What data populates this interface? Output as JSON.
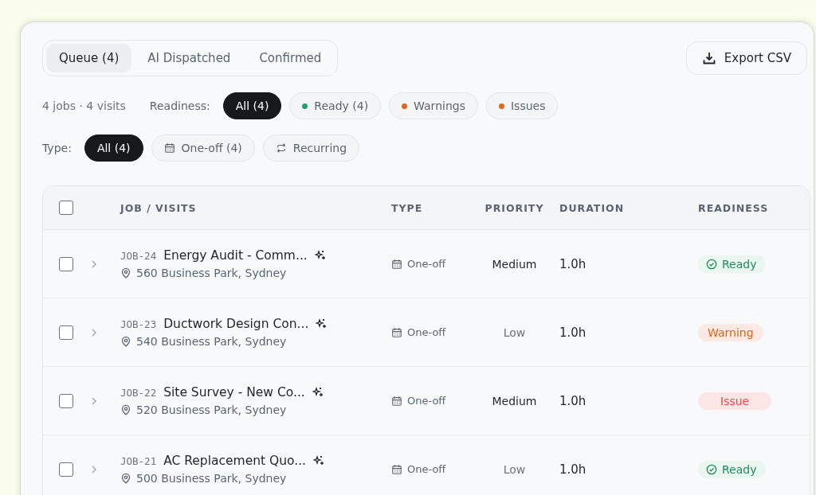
{
  "tabs": [
    {
      "label": "Queue (4)",
      "selected": true
    },
    {
      "label": "AI Dispatched",
      "selected": false
    },
    {
      "label": "Confirmed",
      "selected": false
    }
  ],
  "export_button": "Export CSV",
  "summary": "4 jobs · 4 visits",
  "readiness_filter": {
    "label": "Readiness:",
    "options": [
      {
        "label": "All (4)",
        "selected": true
      },
      {
        "label": "Ready (4)",
        "selected": false,
        "color": "#22a06b"
      },
      {
        "label": "Warnings",
        "selected": false,
        "color": "#e0671c"
      },
      {
        "label": "Issues",
        "selected": false,
        "color": "#e0671c"
      }
    ]
  },
  "type_filter": {
    "label": "Type:",
    "options": [
      {
        "label": "All (4)",
        "selected": true
      },
      {
        "label": "One-off (4)",
        "selected": false,
        "kind": "calendar"
      },
      {
        "label": "Recurring",
        "selected": false,
        "kind": "repeat"
      }
    ]
  },
  "table": {
    "select_all_checked": false,
    "columns": [
      "JOB / VISITS",
      "TYPE",
      "PRIORITY",
      "DURATION",
      "READINESS"
    ],
    "rows": [
      {
        "checked": false,
        "expanded": false,
        "id": "JOB-24",
        "title": "Energy Audit - Comm...",
        "address": "560 Business Park, Sydney",
        "type": "One-off",
        "priority": "Medium",
        "strong": true,
        "duration": "1.0h",
        "readiness": "Ready",
        "kind": "ready"
      },
      {
        "checked": false,
        "expanded": false,
        "id": "JOB-23",
        "title": "Ductwork Design Con...",
        "address": "540 Business Park, Sydney",
        "type": "One-off",
        "priority": "Low",
        "strong": false,
        "duration": "1.0h",
        "readiness": "Warning",
        "kind": "warning"
      },
      {
        "checked": false,
        "expanded": false,
        "id": "JOB-22",
        "title": "Site Survey - New Co...",
        "address": "520 Business Park, Sydney",
        "type": "One-off",
        "priority": "Medium",
        "strong": true,
        "duration": "1.0h",
        "readiness": "Issue",
        "kind": "issue"
      },
      {
        "checked": false,
        "expanded": false,
        "id": "JOB-21",
        "title": "AC Replacement Quo...",
        "address": "500 Business Park, Sydney",
        "type": "One-off",
        "priority": "Low",
        "strong": false,
        "duration": "1.0h",
        "readiness": "Ready",
        "kind": "ready"
      }
    ]
  }
}
